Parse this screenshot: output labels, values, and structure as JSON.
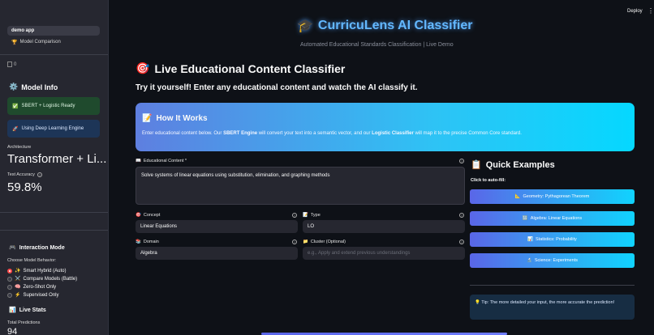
{
  "sidebar": {
    "nav": [
      {
        "label": "demo app"
      },
      {
        "icon": "🏆",
        "label": "Model Comparison"
      }
    ],
    "broken_image_alt": "0",
    "model_info": {
      "icon": "⚙️",
      "title": "Model Info"
    },
    "status_green": {
      "icon": "✅",
      "text": "SBERT + Logistic Ready"
    },
    "status_blue": {
      "icon": "🚀",
      "text": "Using Deep Learning Engine"
    },
    "architecture_label": "Architecture",
    "architecture_value": "Transformer + Li...",
    "accuracy_label": "Test Accuracy",
    "accuracy_value": "59.8%",
    "interaction": {
      "icon": "🎮",
      "title": "Interaction Mode",
      "choose_label": "Choose Model Behavior:"
    },
    "options": [
      {
        "icon": "✨",
        "label": "Smart Hybrid (Auto)",
        "selected": true
      },
      {
        "icon": "⚔️",
        "label": "Compare Models (Battle)",
        "selected": false
      },
      {
        "icon": "🧠",
        "label": "Zero-Shot Only",
        "selected": false
      },
      {
        "icon": "⚡",
        "label": "Supervised Only",
        "selected": false
      }
    ],
    "live_stats": {
      "icon": "📊",
      "title": "Live Stats",
      "total_label": "Total Predictions",
      "total_value": "94"
    }
  },
  "header": {
    "deploy_label": "Deploy",
    "menu_icon": "⋮",
    "title_icon": "🎓",
    "title": "CurricuLens AI Classifier",
    "subtitle": "Automated Educational Standards Classification | Live Demo"
  },
  "main": {
    "section_icon": "🎯",
    "section_title": "Live Educational Content Classifier",
    "intro": "Try it yourself! Enter any educational content and watch the AI classify it.",
    "how": {
      "icon": "📝",
      "title": "How It Works",
      "body_1": "Enter educational content below. Our ",
      "body_b1": "SBERT Engine",
      "body_2": " will convert your text into a semantic vector, and our ",
      "body_b2": "Logistic Classifier",
      "body_3": " will map it to the precise Common Core standard."
    },
    "content_field": {
      "icon": "📖",
      "label": "Educational Content *",
      "value": "Solve systems of linear equations using substitution, elimination, and graphing methods"
    },
    "concept_field": {
      "icon": "🎯",
      "label": "Concept",
      "value": "Linear Equations"
    },
    "type_field": {
      "icon": "📝",
      "label": "Type",
      "value": "LO"
    },
    "domain_field": {
      "icon": "📚",
      "label": "Domain",
      "value": "Algebra"
    },
    "cluster_field": {
      "icon": "📁",
      "label": "Cluster (Optional)",
      "value": "",
      "placeholder": "e.g., Apply and extend previous understandings"
    }
  },
  "quick": {
    "icon": "📋",
    "title": "Quick Examples",
    "subtitle": "Click to auto-fill:",
    "buttons": [
      {
        "icon": "📐",
        "label": "Geometry: Pythagorean Theorem"
      },
      {
        "icon": "🔢",
        "label": "Algebra: Linear Equations"
      },
      {
        "icon": "📊",
        "label": "Statistics: Probability"
      },
      {
        "icon": "🔬",
        "label": "Science: Experiments"
      }
    ],
    "tip_icon": "💡",
    "tip": "Tip: The more detailed your input, the more accurate the prediction!"
  }
}
